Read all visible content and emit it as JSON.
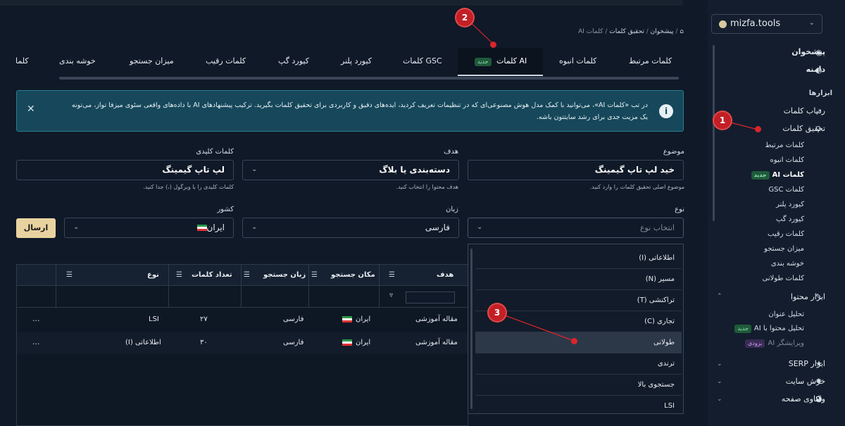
{
  "breadcrumb": {
    "home_icon": "home-icon",
    "items": [
      "پیشخوان",
      "تحقیق کلمات",
      "کلمات AI"
    ]
  },
  "tabs": [
    {
      "label": "کلمات مرتبط"
    },
    {
      "label": "کلمات AI",
      "badge": "جدید",
      "active": true
    },
    {
      "label": "کلمات انبوه"
    },
    {
      "label": "کلمات GSC"
    },
    {
      "label": "کیورد پلنر"
    },
    {
      "label": "کیورد گپ"
    },
    {
      "label": "کلمات رقیب"
    },
    {
      "label": "میزان جستجو"
    },
    {
      "label": "خوشه بندی"
    },
    {
      "label": "کلما"
    }
  ],
  "info_banner": {
    "line1": "در تب «کلمات AI»، می‌توانید با کمک مدل هوش مصنوعی‌ای که در تنظیمات تعریف کردید، ایده‌های دقیق و کاربردی برای تحقیق کلمات بگیرید. ترکیب پیشنهادهای AI با داده‌های واقعی سئوی میزفا تواز، می‌تونه",
    "line2": "یک مزیت جدی برای رشد سایتتون باشه."
  },
  "form": {
    "topic": {
      "label": "موضوع",
      "value": "خید لپ تاپ گیمینگ",
      "help": "موضوع اصلی تحقیق کلمات را وارد کنید."
    },
    "goal": {
      "label": "هدف",
      "value": "دسته‌بندی یا بلاگ",
      "help": "هدف محتوا را انتخاب کنید."
    },
    "keywords": {
      "label": "کلمات کلیدی",
      "value": "لپ تاپ گیمینگ",
      "help": "کلمات کلیدی را با ویرگول (،) جدا کنید."
    },
    "type": {
      "label": "نوع",
      "placeholder": "انتخاب نوع"
    },
    "language": {
      "label": "زبان",
      "value": "فارسی"
    },
    "country": {
      "label": "کشور",
      "value": "ایران"
    },
    "submit_label": "ارسال"
  },
  "table": {
    "columns": [
      "هدف",
      "مکان جستجو",
      "زبان جستجو",
      "تعداد کلمات",
      "نوع"
    ],
    "rows": [
      {
        "goal": "مقاله آموزشی",
        "location": "ایران",
        "language": "فارسی",
        "count": "۲۷",
        "type": "LSI",
        "actions": "..."
      },
      {
        "goal": "مقاله آموزشی",
        "location": "ایران",
        "language": "فارسی",
        "count": "۳۰",
        "type": "اطلاعاتی (I)",
        "actions": "..."
      }
    ]
  },
  "type_dropdown": {
    "options": [
      "اطلاعاتی (I)",
      "مسیر (N)",
      "تراکنشی (T)",
      "تجاری (C)",
      "طولانی",
      "ترندی",
      "جستجوی بالا",
      "LSI"
    ],
    "highlighted_index": 4
  },
  "sidebar": {
    "site_selector": "mizfa.tools",
    "top_items": [
      {
        "label": "پیشخوان",
        "icon": "dashboard-icon"
      },
      {
        "label": "دامنه",
        "icon": "globe-icon"
      }
    ],
    "section_title": "ابزارها",
    "tools": [
      {
        "label": "ردیاب کلمات",
        "icon": "chart-icon"
      },
      {
        "label": "تحقیق کلمات",
        "icon": "search-icon"
      }
    ],
    "research_subitems": [
      "کلمات مرتبط",
      "کلمات انبوه",
      "کلمات AI",
      "کلمات GSC",
      "کیورد پلنر",
      "کیورد گپ",
      "کلمات رقیب",
      "میزان جستجو",
      "خوشه بندی",
      "کلمات طولانی"
    ],
    "research_active_badge": "جدید",
    "content_tool": {
      "label": "ابزار محتوا",
      "icon": "pencil-icon"
    },
    "content_subitems": [
      {
        "label": "تحلیل عنوان"
      },
      {
        "label": "تحلیل محتوا با AI",
        "badge": "جدید"
      },
      {
        "label": "ویرایشگر AI",
        "badge": "بزودی"
      }
    ],
    "bottom_items": [
      {
        "label": "ابزار SERP",
        "icon": "trophy-icon"
      },
      {
        "label": "خزش سایت",
        "icon": "bug-icon"
      },
      {
        "label": "واکاوی صفحه",
        "icon": "palette-icon"
      }
    ]
  },
  "annotations": [
    "1",
    "2",
    "3"
  ],
  "colors": {
    "accent": "#e8d3a0",
    "marker": "#c21f26",
    "info_bg": "#16475a",
    "badge_bg": "#1f5a3b"
  }
}
